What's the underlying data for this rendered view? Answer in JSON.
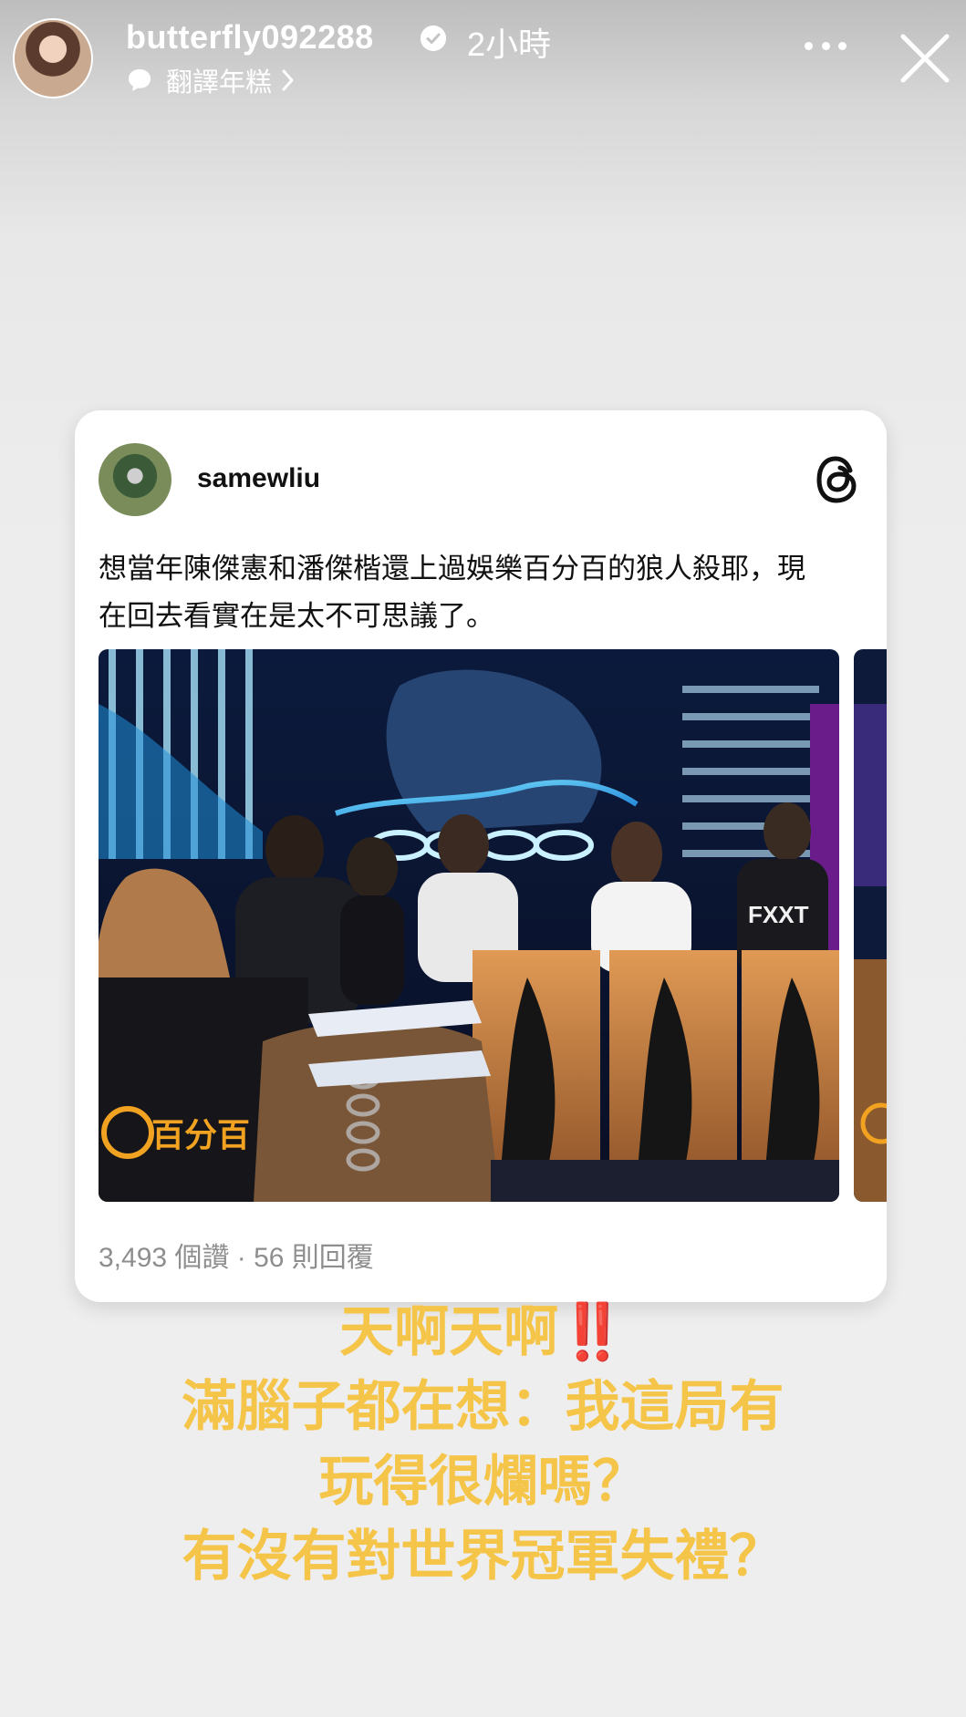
{
  "story_header": {
    "username": "butterfly092288",
    "time_ago": "2小時",
    "translate_label": "翻譯年糕"
  },
  "post_card": {
    "username": "samewliu",
    "text": "想當年陳傑憲和潘傑楷還上過娛樂百分百的狼人殺耶，現\n在回去看實在是太不可思議了。",
    "photo_logo": "百分百",
    "shirt_text": "FXXT",
    "stats": "3,493 個讚 · 56 則回覆"
  },
  "caption": {
    "line1": "天啊天啊",
    "line1_emoji": "‼️",
    "line2": "滿腦子都在想：我這局有",
    "line3": "玩得很爛嗎？",
    "line4": "有沒有對世界冠軍失禮？"
  }
}
